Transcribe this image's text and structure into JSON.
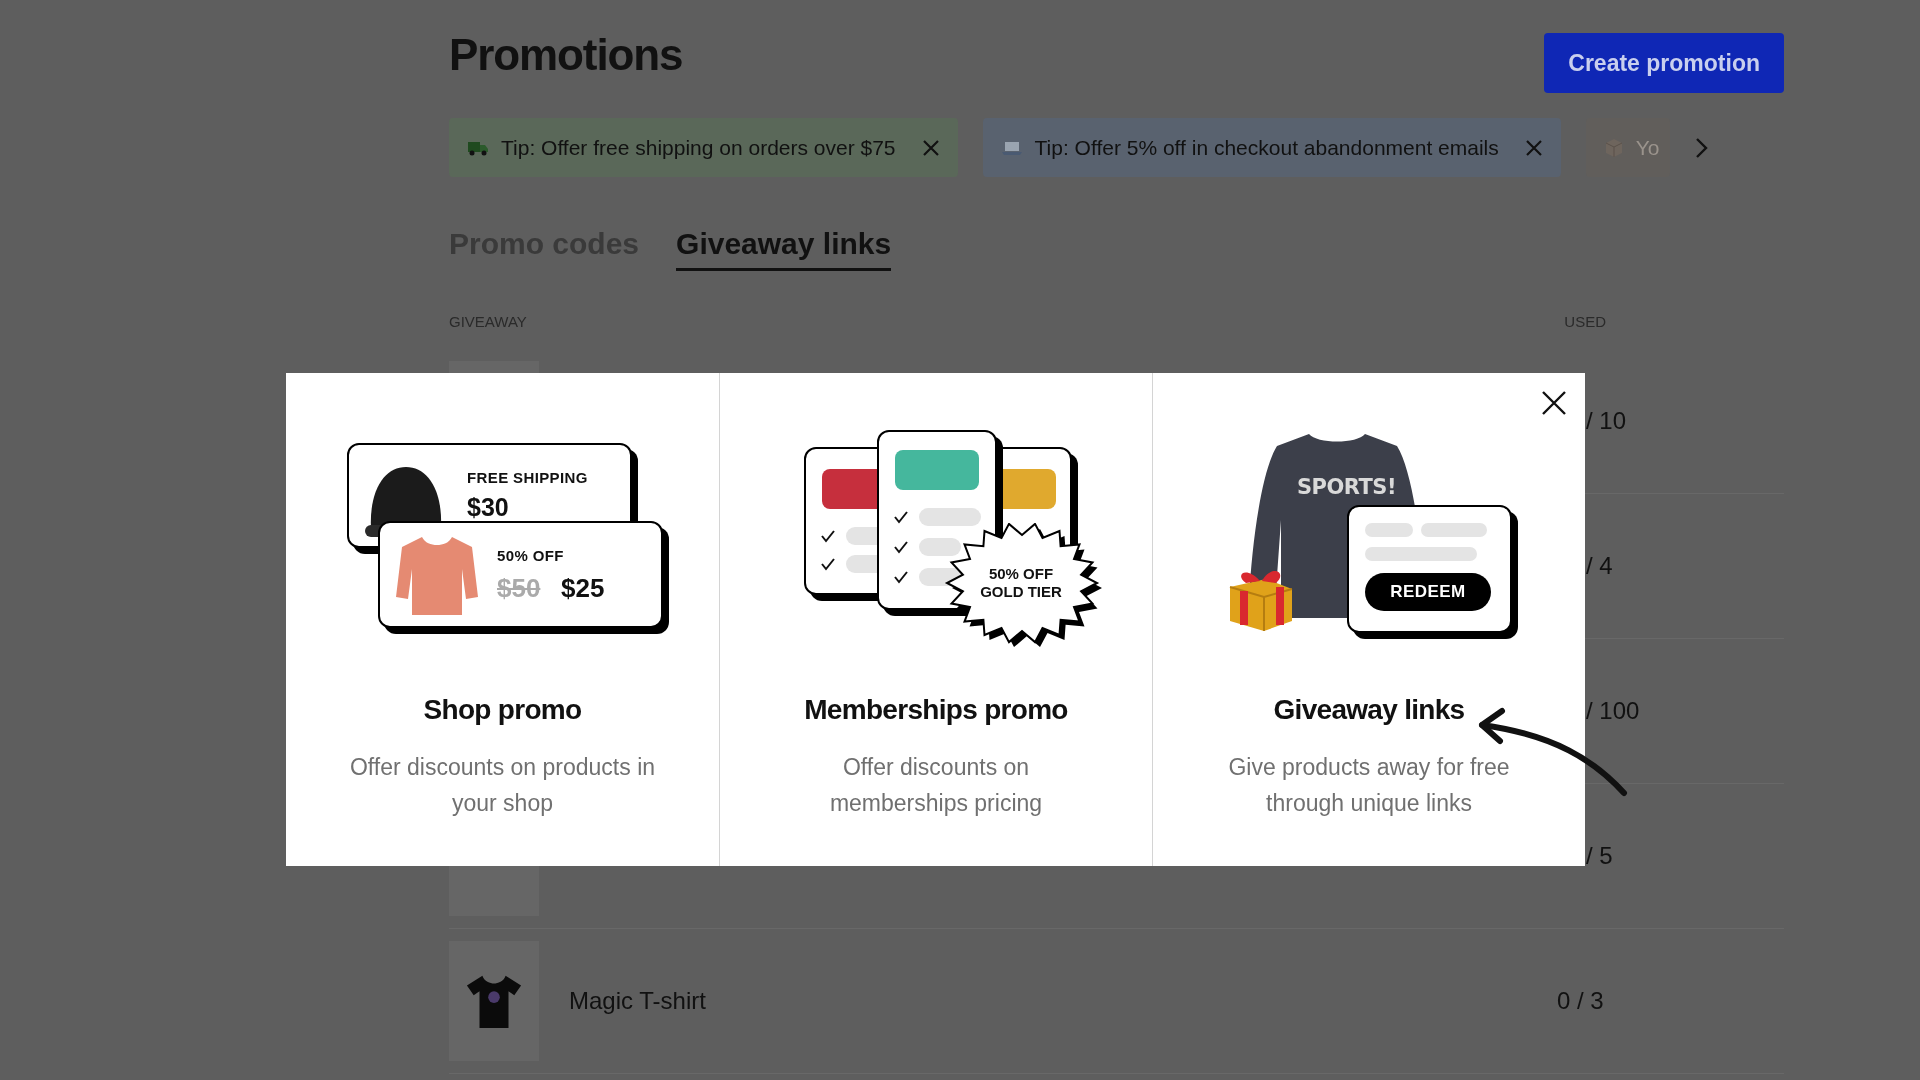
{
  "header": {
    "title": "Promotions",
    "button": "Create promotion"
  },
  "tips": [
    {
      "kind": "shipping",
      "text": "Tip: Offer free shipping on orders over $75"
    },
    {
      "kind": "email",
      "text": "Tip: Offer 5% off in checkout abandonment emails"
    },
    {
      "kind": "box",
      "text": "Yo"
    }
  ],
  "tabs": [
    {
      "label": "Promo codes",
      "selected": false
    },
    {
      "label": "Giveaway links",
      "selected": true
    }
  ],
  "table": {
    "columns": [
      "GIVEAWAY",
      "USED"
    ],
    "rows": [
      {
        "used": "/ 10"
      },
      {
        "used": "/ 4"
      },
      {
        "used": "/ 100"
      },
      {
        "used": "/ 5"
      },
      {
        "name": "Magic T-shirt",
        "used": "0 / 3"
      }
    ]
  },
  "modal": {
    "options": [
      {
        "kind": "shop",
        "title": "Shop promo",
        "description": "Offer discounts on products in your shop",
        "art": [
          "FREE SHIPPING",
          "$30",
          "50% OFF",
          "$50",
          "$25"
        ]
      },
      {
        "kind": "memberships",
        "title": "Memberships promo",
        "description": "Offer discounts on memberships pricing",
        "art": [
          "50% OFF",
          "GOLD TIER"
        ]
      },
      {
        "kind": "giveaway",
        "title": "Giveaway links",
        "description": "Give products away for free through unique links",
        "art": [
          "SPORTS!",
          "REDEEM"
        ]
      }
    ]
  }
}
